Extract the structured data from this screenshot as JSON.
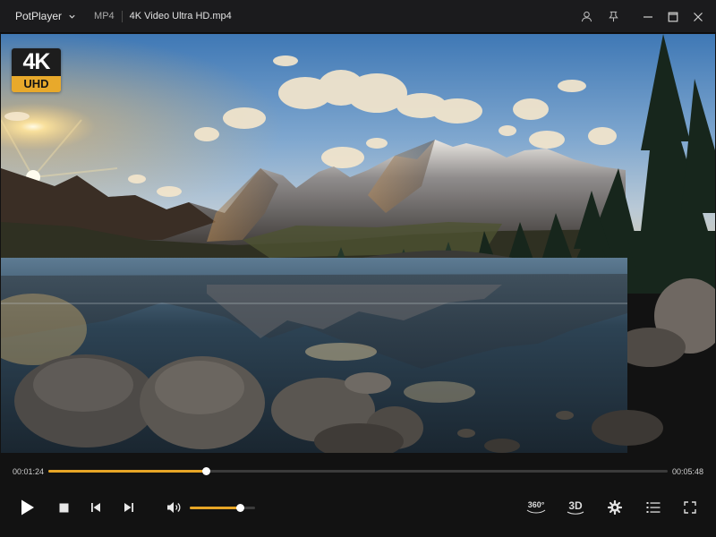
{
  "titlebar": {
    "app_name": "PotPlayer",
    "format": "MP4",
    "filename": "4K Video Ultra HD.mp4",
    "buttons": [
      "account-icon",
      "pin-icon",
      "minimize-icon",
      "maximize-icon",
      "close-icon"
    ]
  },
  "video": {
    "badge_top": "4K",
    "badge_bottom": "UHD"
  },
  "playback": {
    "current_time": "00:01:24",
    "total_time": "00:05:48",
    "progress_fraction": 0.255,
    "volume_fraction": 0.77,
    "label_360": "360°",
    "label_3d": "3D"
  },
  "colors": {
    "accent": "#e6a526",
    "background": "#121212",
    "titlebar": "#1b1b1d",
    "badge_gold": "#e8a92b"
  }
}
